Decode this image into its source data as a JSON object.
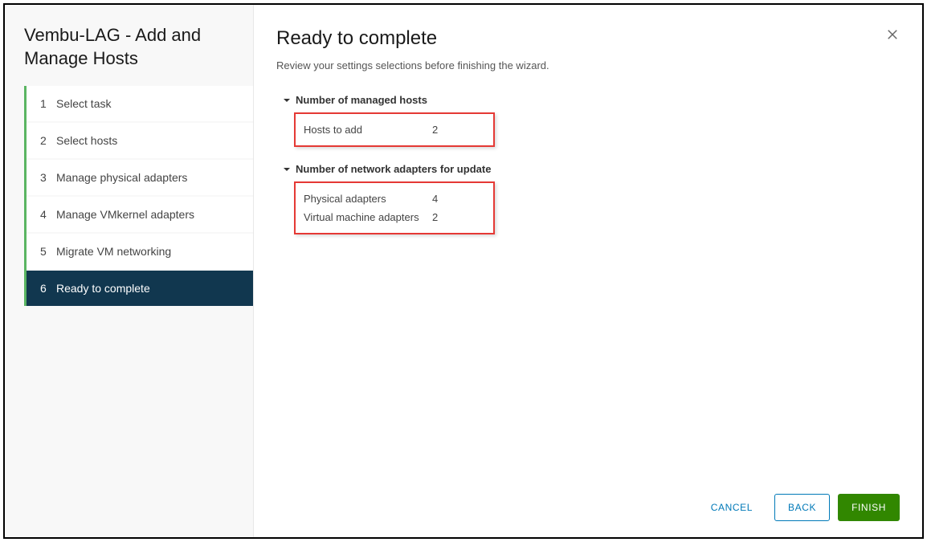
{
  "sidebar": {
    "title": "Vembu-LAG - Add and Manage Hosts",
    "steps": [
      {
        "num": "1",
        "label": "Select task"
      },
      {
        "num": "2",
        "label": "Select hosts"
      },
      {
        "num": "3",
        "label": "Manage physical adapters"
      },
      {
        "num": "4",
        "label": "Manage VMkernel adapters"
      },
      {
        "num": "5",
        "label": "Migrate VM networking"
      },
      {
        "num": "6",
        "label": "Ready to complete"
      }
    ]
  },
  "main": {
    "title": "Ready to complete",
    "subtitle": "Review your settings selections before finishing the wizard."
  },
  "sections": {
    "hosts": {
      "header": "Number of managed hosts",
      "rows": [
        {
          "label": "Hosts to add",
          "value": "2"
        }
      ]
    },
    "adapters": {
      "header": "Number of network adapters for update",
      "rows": [
        {
          "label": "Physical adapters",
          "value": "4"
        },
        {
          "label": "Virtual machine adapters",
          "value": "2"
        }
      ]
    }
  },
  "footer": {
    "cancel": "CANCEL",
    "back": "BACK",
    "finish": "FINISH"
  }
}
